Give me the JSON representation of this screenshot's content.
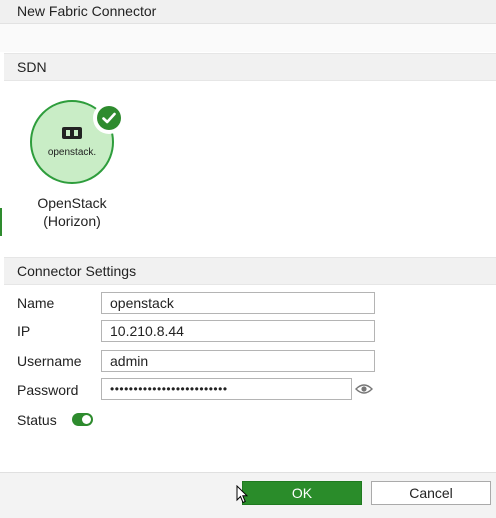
{
  "dialog": {
    "title": "New Fabric Connector"
  },
  "sdn_section": {
    "header": "SDN",
    "tile": {
      "logo_text": "openstack.",
      "label_line1": "OpenStack",
      "label_line2": "(Horizon)",
      "selected": true,
      "icon": "openstack-logo-icon"
    }
  },
  "settings": {
    "header": "Connector Settings",
    "fields": {
      "name": {
        "label": "Name",
        "value": "openstack"
      },
      "ip": {
        "label": "IP",
        "value": "10.210.8.44"
      },
      "username": {
        "label": "Username",
        "value": "admin"
      },
      "password": {
        "label": "Password",
        "value": "•••••••••••••••••••••••••"
      }
    },
    "status": {
      "label": "Status",
      "enabled": true
    }
  },
  "footer": {
    "ok_label": "OK",
    "cancel_label": "Cancel"
  },
  "colors": {
    "accent": "#2e8b2e",
    "tile_fill": "#c9edc6"
  }
}
